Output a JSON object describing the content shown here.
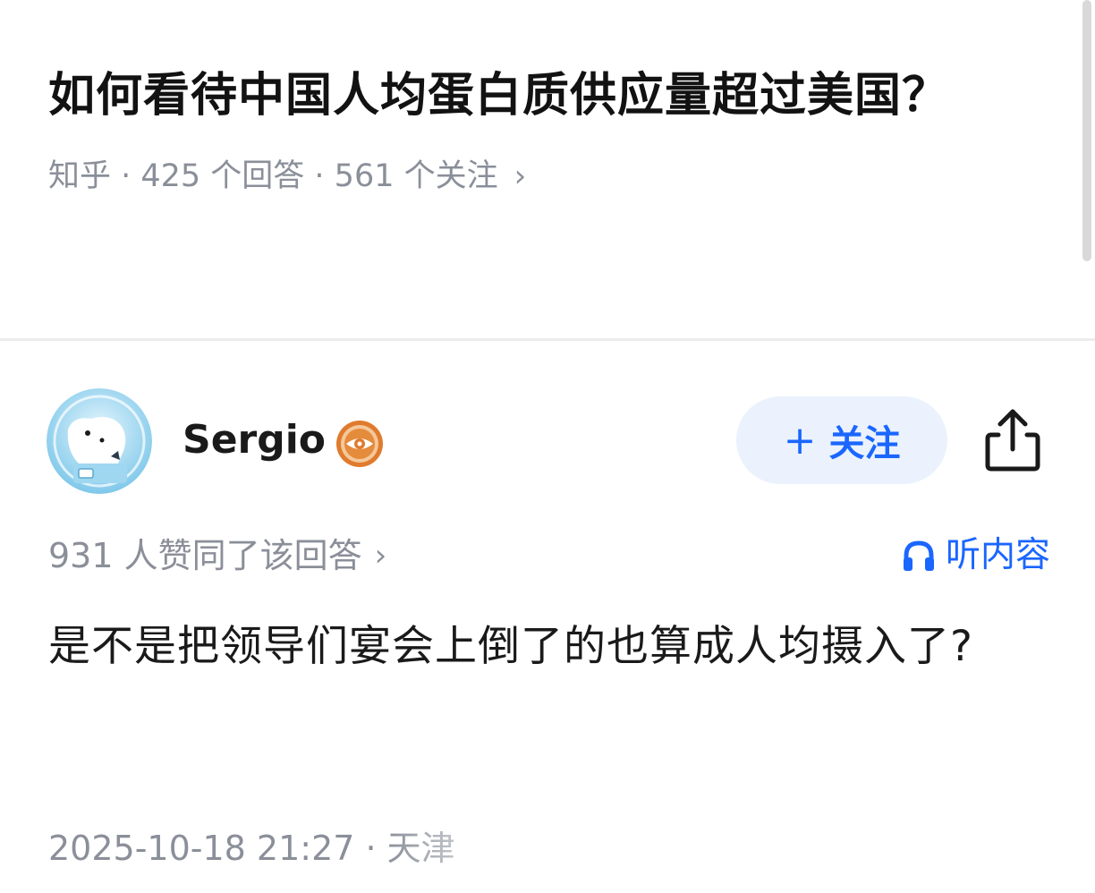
{
  "question": {
    "title": "如何看待中国人均蛋白质供应量超过美国？",
    "meta": "知乎 · 425 个回答 · 561 个关注",
    "meta_chevron": "›"
  },
  "author": {
    "name": "Sergio",
    "follow_label": "关注",
    "follow_icon": "plus-icon",
    "share_icon": "share-icon",
    "badge_icon": "eye-badge-icon"
  },
  "stats": {
    "votes": "931 人赞同了该回答",
    "votes_chevron": "›",
    "listen_label": "听内容",
    "listen_icon": "headphones-icon"
  },
  "answer": {
    "text": "是不是把领导们宴会上倒了的也算成人均摄入了?"
  },
  "footer": {
    "timestamp": "2025-10-18 21:27 · 天津"
  },
  "colors": {
    "accent": "#1a66ff",
    "follow_bg": "#ebf2fe",
    "muted_text": "#8a8f99",
    "badge": "#e07b2e"
  }
}
